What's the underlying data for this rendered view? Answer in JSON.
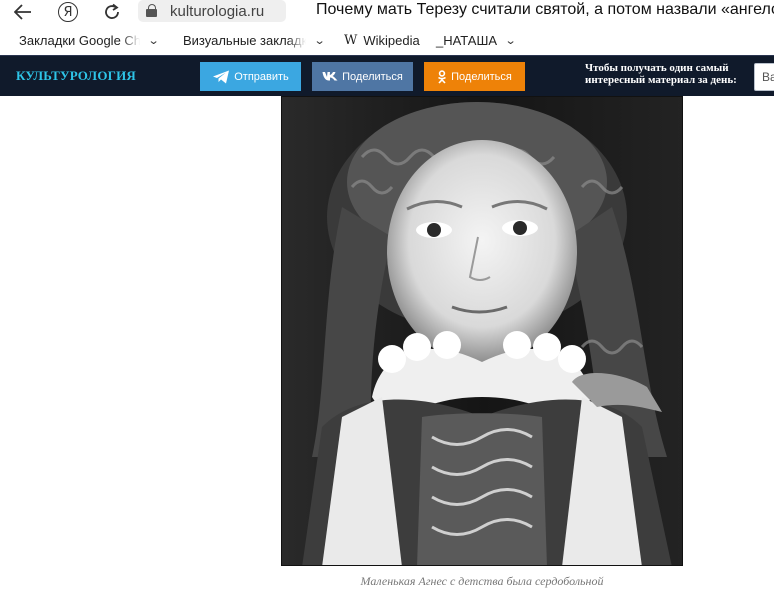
{
  "browser": {
    "url": "kulturologia.ru",
    "page_title": "Почему мать Терезу считали святой, а потом назвали «ангело",
    "yandex_label": "Я"
  },
  "bookmarks": [
    {
      "label": "Закладки Google Chr",
      "has_menu": true
    },
    {
      "label": "Визуальные закладки",
      "has_menu": true
    },
    {
      "label": "Wikipedia",
      "icon_text": "W",
      "has_menu": false
    },
    {
      "label": "_НАТАША",
      "has_menu": true
    }
  ],
  "site_header": {
    "logo": "КУЛЬТУРОЛОГИЯ",
    "share_buttons": [
      {
        "label": "Отправить",
        "network": "telegram",
        "color": "#3ba7e1"
      },
      {
        "label": "Поделиться",
        "network": "vk",
        "color": "#4f76a4"
      },
      {
        "label": "Поделиться",
        "network": "odnoklassniki",
        "color": "#ee8208"
      }
    ],
    "subscribe_text": "Чтобы получать один самый интересный материал за день:",
    "subscribe_input_value": "Ва",
    "background_color": "#101a2b",
    "logo_color": "#2ec5e8"
  },
  "article": {
    "photo_description_icon": "girl-portrait-photo",
    "caption": "Маленькая Агнес с детства была сердобольной"
  }
}
